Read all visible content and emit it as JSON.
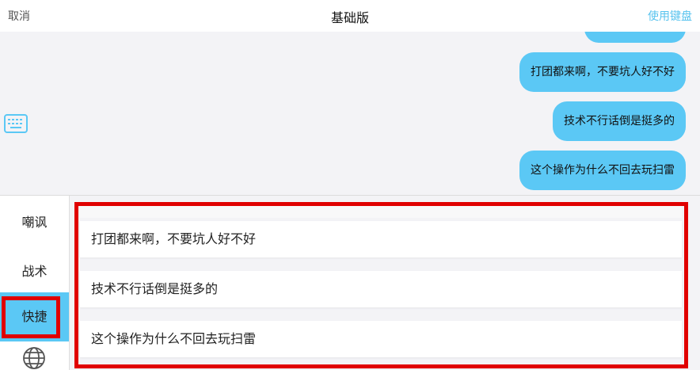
{
  "header": {
    "cancel_label": "取消",
    "title": "基础版",
    "use_keyboard_label": "使用键盘"
  },
  "chat": {
    "messages": [
      "打团都来啊，不要坑人好不好",
      "技术不行话倒是挺多的",
      "这个操作为什么不回去玩扫雷"
    ]
  },
  "sidebar": {
    "items": [
      {
        "label": "嘲讽"
      },
      {
        "label": "战术"
      },
      {
        "label": "快捷"
      }
    ],
    "active_index": 2,
    "globe_icon": "globe-icon"
  },
  "phrases": [
    "打团都来啊，不要坑人好不好",
    "技术不行话倒是挺多的",
    "这个操作为什么不回去玩扫雷"
  ],
  "colors": {
    "accent": "#5bc8f5",
    "highlight": "#e00000",
    "link": "#58c3ee"
  }
}
